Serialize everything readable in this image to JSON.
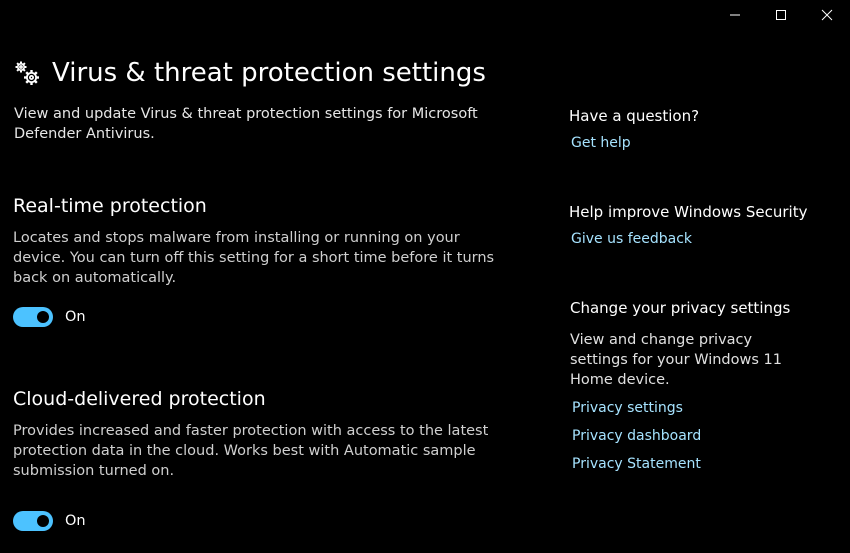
{
  "window": {
    "controls": {
      "minimize": "minimize-icon",
      "maximize": "maximize-icon",
      "close": "close-icon"
    }
  },
  "header": {
    "icon": "gears-icon",
    "title": "Virus & threat protection settings",
    "description": "View and update Virus & threat protection settings for Microsoft Defender Antivirus."
  },
  "sections": {
    "realtime": {
      "title": "Real-time protection",
      "description": "Locates and stops malware from installing or running on your device. You can turn off this setting for a short time before it turns back on automatically.",
      "toggle_state": "On"
    },
    "cloud": {
      "title": "Cloud-delivered protection",
      "description": "Provides increased and faster protection with access to the latest protection data in the cloud. Works best with Automatic sample submission turned on.",
      "toggle_state": "On"
    }
  },
  "side": {
    "question": {
      "heading": "Have a question?",
      "link": "Get help"
    },
    "improve": {
      "heading": "Help improve Windows Security",
      "link": "Give us feedback"
    },
    "privacy": {
      "heading": "Change your privacy settings",
      "text": "View and change privacy settings for your Windows 11 Home device.",
      "links": [
        "Privacy settings",
        "Privacy dashboard",
        "Privacy Statement"
      ]
    }
  },
  "colors": {
    "background": "#000000",
    "accent": "#4cc2ff",
    "link": "#a6e3ff"
  }
}
